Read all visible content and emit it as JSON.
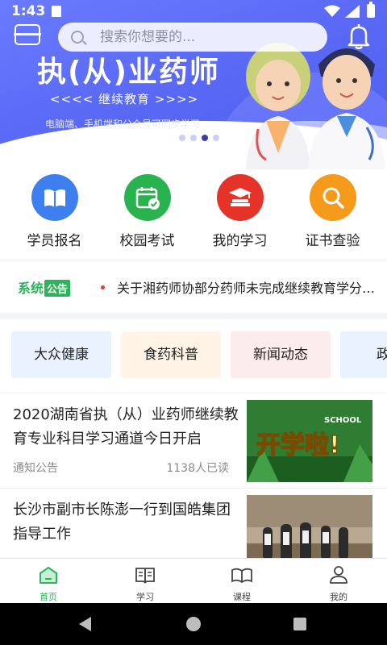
{
  "status_bar": {
    "time": "1:43"
  },
  "search": {
    "placeholder": "搜索你想要的..."
  },
  "banner": {
    "title": "执(从)业药师",
    "subtitle": "<<<<   继续教育   >>>>",
    "note": "电脑端、手机端和公众号可同步学习",
    "slide_count": 4,
    "active_slide": 3
  },
  "quick_menu": [
    {
      "label": "学员报名",
      "icon": "book-icon",
      "color": "#3e7ff0"
    },
    {
      "label": "校园考试",
      "icon": "calendar-check-icon",
      "color": "#29b34f"
    },
    {
      "label": "我的学习",
      "icon": "graduation-books-icon",
      "color": "#e6332a"
    },
    {
      "label": "证书查验",
      "icon": "magnifier-icon",
      "color": "#f59a1b"
    }
  ],
  "notice": {
    "brand": "系统",
    "brand_tag": "公告",
    "text": "关于湘药师协部分药师未完成继续教育学分的通知"
  },
  "categories": [
    {
      "label": "大众健康",
      "bg": "#eaf1ff"
    },
    {
      "label": "食药科普",
      "bg": "#fff4e6"
    },
    {
      "label": "新闻动态",
      "bg": "#fdecec"
    },
    {
      "label": "政策",
      "bg": "#eaf1ff"
    }
  ],
  "news": [
    {
      "title": "2020湖南省执（从）业药师继续教育专业科目学习通道今日开启",
      "source": "通知公告",
      "reads": "1138人已读",
      "thumb_text": "开学啦!",
      "thumb_tag": "SCHOOL"
    },
    {
      "title": "长沙市副市长陈澎一行到国皓集团指导工作",
      "source": "",
      "reads": ""
    }
  ],
  "bottom_nav": [
    {
      "label": "首页",
      "icon": "home-icon",
      "active": true
    },
    {
      "label": "学习",
      "icon": "open-book-icon",
      "active": false
    },
    {
      "label": "课程",
      "icon": "course-book-icon",
      "active": false
    },
    {
      "label": "我的",
      "icon": "person-icon",
      "active": false
    }
  ],
  "colors": {
    "accent": "#2db35a",
    "banner": "#5a6af5"
  }
}
